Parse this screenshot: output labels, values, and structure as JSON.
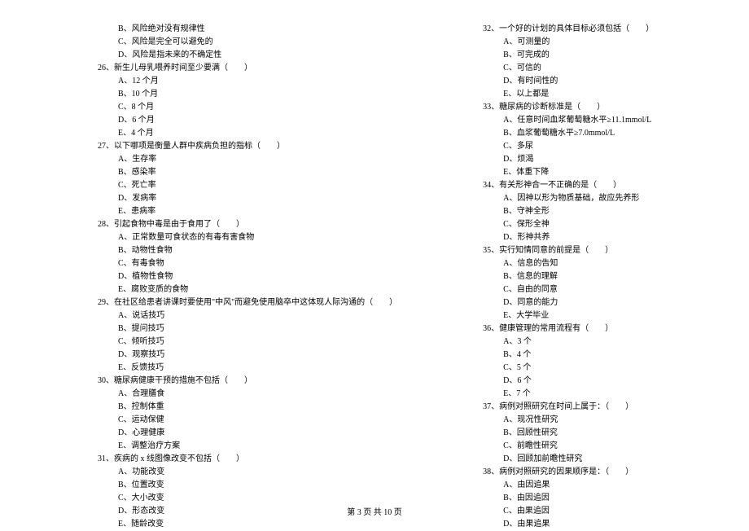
{
  "footer": "第 3 页 共 10 页",
  "left_column": [
    {
      "type": "option",
      "text": "B、风险绝对没有规律性"
    },
    {
      "type": "option",
      "text": "C、风险是完全可以避免的"
    },
    {
      "type": "option",
      "text": "D、风险是指未来的不确定性"
    },
    {
      "type": "question",
      "text": "26、新生儿母乳喂养时间至少要满（　　）"
    },
    {
      "type": "option",
      "text": "A、12 个月"
    },
    {
      "type": "option",
      "text": "B、10 个月"
    },
    {
      "type": "option",
      "text": "C、8 个月"
    },
    {
      "type": "option",
      "text": "D、6 个月"
    },
    {
      "type": "option",
      "text": "E、4 个月"
    },
    {
      "type": "question",
      "text": "27、以下哪项是衡量人群中疾病负担的指标（　　）"
    },
    {
      "type": "option",
      "text": "A、生存率"
    },
    {
      "type": "option",
      "text": "B、感染率"
    },
    {
      "type": "option",
      "text": "C、死亡率"
    },
    {
      "type": "option",
      "text": "D、发病率"
    },
    {
      "type": "option",
      "text": "E、患病率"
    },
    {
      "type": "question",
      "text": "28、引起食物中毒是由于食用了（　　）"
    },
    {
      "type": "option",
      "text": "A、正常数量可食状态的有毒有害食物"
    },
    {
      "type": "option",
      "text": "B、动物性食物"
    },
    {
      "type": "option",
      "text": "C、有毒食物"
    },
    {
      "type": "option",
      "text": "D、植物性食物"
    },
    {
      "type": "option",
      "text": "E、腐败变质的食物"
    },
    {
      "type": "question",
      "text": "29、在社区给患者讲课时要使用\"中风\"而避免使用脑卒中这体现人际沟通的（　　）"
    },
    {
      "type": "option",
      "text": "A、说话技巧"
    },
    {
      "type": "option",
      "text": "B、提问技巧"
    },
    {
      "type": "option",
      "text": "C、倾听技巧"
    },
    {
      "type": "option",
      "text": "D、观察技巧"
    },
    {
      "type": "option",
      "text": "E、反馈技巧"
    },
    {
      "type": "question",
      "text": "30、糖尿病健康干预的措施不包括（　　）"
    },
    {
      "type": "option",
      "text": "A、合理膳食"
    },
    {
      "type": "option",
      "text": "B、控制体重"
    },
    {
      "type": "option",
      "text": "C、运动保健"
    },
    {
      "type": "option",
      "text": "D、心理健康"
    },
    {
      "type": "option",
      "text": "E、调整治疗方案"
    },
    {
      "type": "question",
      "text": "31、疾病的 x 线图像改变不包括（　　）"
    },
    {
      "type": "option",
      "text": "A、功能改变"
    },
    {
      "type": "option",
      "text": "B、位置改变"
    },
    {
      "type": "option",
      "text": "C、大小改变"
    },
    {
      "type": "option",
      "text": "D、形态改变"
    },
    {
      "type": "option",
      "text": "E、随龄改变"
    }
  ],
  "right_column": [
    {
      "type": "question",
      "text": "32、一个好的计划的具体目标必须包括（　　）"
    },
    {
      "type": "option",
      "text": "A、可测量的"
    },
    {
      "type": "option",
      "text": "B、可完成的"
    },
    {
      "type": "option",
      "text": "C、可信的"
    },
    {
      "type": "option",
      "text": "D、有时间性的"
    },
    {
      "type": "option",
      "text": "E、以上都是"
    },
    {
      "type": "question",
      "text": "33、糖尿病的诊断标准是（　　）"
    },
    {
      "type": "option",
      "text": "A、任意时间血浆葡萄糖水平≥11.1mmol/L"
    },
    {
      "type": "option",
      "text": "B、血浆葡萄糖水平≥7.0mmol/L"
    },
    {
      "type": "option",
      "text": "C、多尿"
    },
    {
      "type": "option",
      "text": "D、烦渴"
    },
    {
      "type": "option",
      "text": "E、体重下降"
    },
    {
      "type": "question",
      "text": "34、有关形神合一不正确的是（　　）"
    },
    {
      "type": "option",
      "text": "A、因神以形为物质基础，故应先养形"
    },
    {
      "type": "option",
      "text": "B、守神全形"
    },
    {
      "type": "option",
      "text": "C、保形全神"
    },
    {
      "type": "option",
      "text": "D、形神共养"
    },
    {
      "type": "question",
      "text": "35、实行知情同意的前提是（　　）"
    },
    {
      "type": "option",
      "text": "A、信息的告知"
    },
    {
      "type": "option",
      "text": "B、信息的理解"
    },
    {
      "type": "option",
      "text": "C、自由的同意"
    },
    {
      "type": "option",
      "text": "D、同意的能力"
    },
    {
      "type": "option",
      "text": "E、大学毕业"
    },
    {
      "type": "question",
      "text": "36、健康管理的常用流程有（　　）"
    },
    {
      "type": "option",
      "text": "A、3 个"
    },
    {
      "type": "option",
      "text": "B、4 个"
    },
    {
      "type": "option",
      "text": "C、5 个"
    },
    {
      "type": "option",
      "text": "D、6 个"
    },
    {
      "type": "option",
      "text": "E、7 个"
    },
    {
      "type": "question",
      "text": "37、病例对照研究在时间上属于：（　　）"
    },
    {
      "type": "option",
      "text": "A、现况性研究"
    },
    {
      "type": "option",
      "text": "B、回顾性研究"
    },
    {
      "type": "option",
      "text": "C、前瞻性研究"
    },
    {
      "type": "option",
      "text": "D、回顾加前瞻性研究"
    },
    {
      "type": "question",
      "text": "38、病例对照研究的因果顺序是：（　　）"
    },
    {
      "type": "option",
      "text": "A、由因追果"
    },
    {
      "type": "option",
      "text": "B、由因追因"
    },
    {
      "type": "option",
      "text": "C、由果追因"
    },
    {
      "type": "option",
      "text": "D、由果追果"
    }
  ]
}
